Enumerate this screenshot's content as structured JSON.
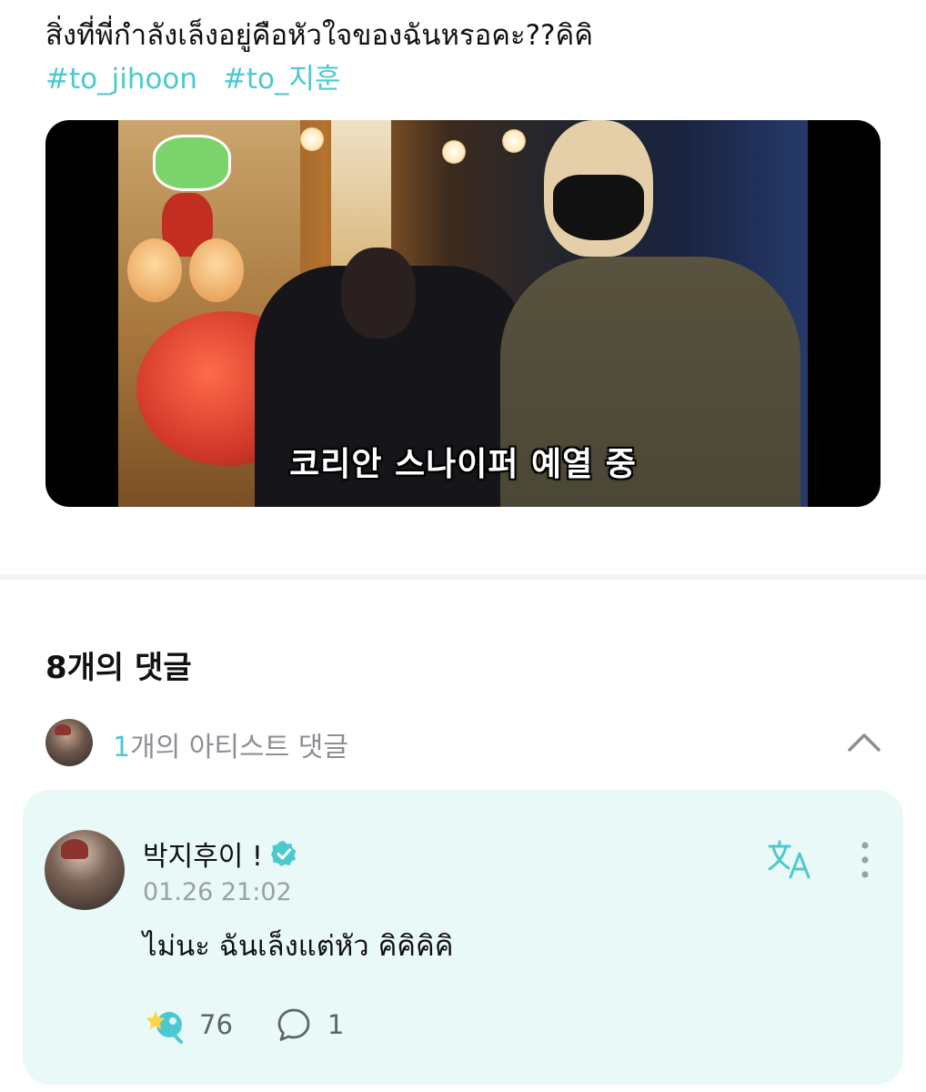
{
  "post": {
    "text": "สิ่งที่พี่กำลังเล็งอยู่คือหัวใจของฉันหรอคะ??คิคิ",
    "hashtags": [
      "#to_jihoon",
      "#to_지훈"
    ],
    "video_caption": "코리안 스나이퍼 예열 중"
  },
  "comments": {
    "header": "8개의 댓글",
    "artist_row": {
      "count": "1",
      "label": "개의 아티스트 댓글",
      "icon": "chevron-up-icon"
    },
    "artist_comment": {
      "author": "박지후이 !",
      "verified": true,
      "timestamp": "01.26 21:02",
      "text": "ไม่นะ ฉันเล็งแต่หัว คิคิคิคิ",
      "likes": "76",
      "replies": "1",
      "icons": [
        "translate-icon",
        "more-options-icon",
        "like-icon",
        "reply-icon",
        "verified-badge-icon"
      ]
    }
  },
  "colors": {
    "accent": "#4cc9cf",
    "card_background": "#e9f9f8",
    "muted_text": "#8b8f94",
    "separator": "#f2f3f4"
  }
}
